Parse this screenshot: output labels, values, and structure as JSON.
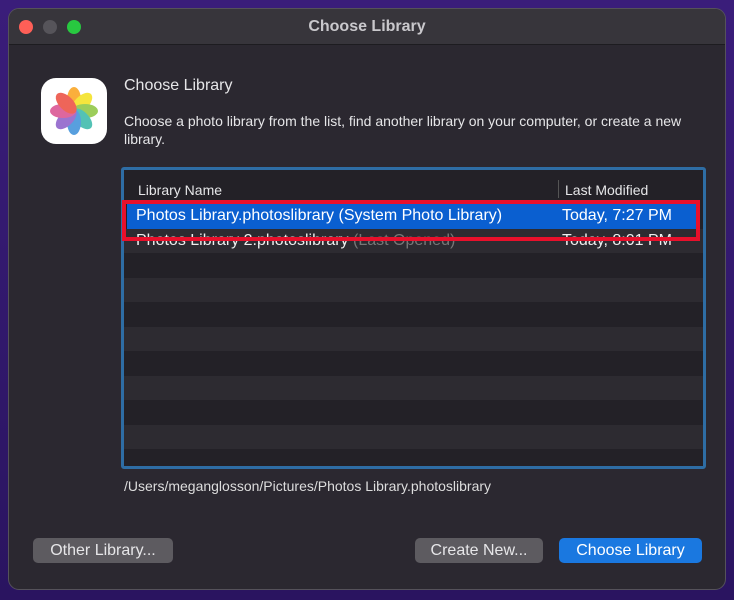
{
  "window": {
    "title": "Choose Library"
  },
  "heading": "Choose Library",
  "description": "Choose a photo library from the list, find another library on your computer, or create a new library.",
  "table": {
    "columns": [
      "Library Name",
      "Last Modified"
    ],
    "rows": [
      {
        "name": "Photos Library.photoslibrary",
        "note": "(System Photo Library)",
        "modified": "Today, 7:27 PM",
        "selected": true
      },
      {
        "name": "Photos Library 2.photoslibrary",
        "note": "(Last Opened)",
        "modified": "Today, 8:01 PM",
        "selected": false
      }
    ]
  },
  "path": "/Users/meganglosson/Pictures/Photos Library.photoslibrary",
  "buttons": {
    "other": "Other Library...",
    "create": "Create New...",
    "choose": "Choose Library"
  },
  "colors": {
    "accent": "#1a78e0",
    "selection": "#0a5fd0",
    "highlight": "#e8102b"
  }
}
